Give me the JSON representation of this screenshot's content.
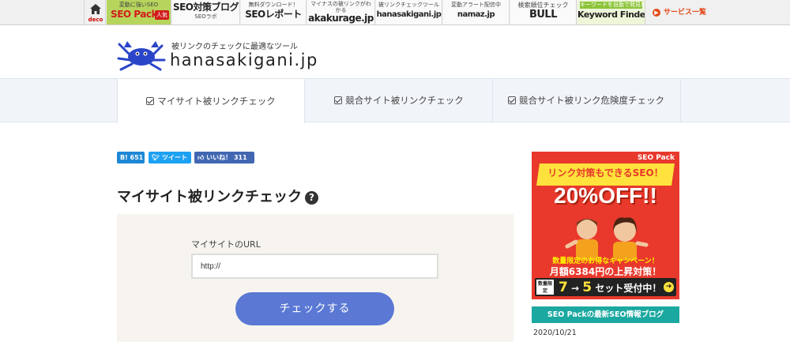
{
  "topbar": {
    "home": {
      "icon": "home-icon",
      "label": "deco"
    },
    "services": [
      {
        "sub": "変動に強いSEO",
        "name": "SEO Pack",
        "badge": "人気"
      },
      {
        "sub": "",
        "name": "SEO対策ブログ",
        "name2": "SEOラボ"
      },
      {
        "sub": "無料ダウンロード！",
        "name": "SEOレポート"
      },
      {
        "sub": "マイナスの被リンクがわかる",
        "name": "akakurage.jp"
      },
      {
        "sub": "被リンクチェックツール",
        "name": "hanasakigani.jp"
      },
      {
        "sub": "変動アラート配信中",
        "name": "namaz.jp"
      },
      {
        "sub": "検索順位チェック",
        "name": "BULL"
      },
      {
        "sub": "キーワードを自動で発見!",
        "name": "Keyword Finder"
      }
    ],
    "all_services": "サービス一覧"
  },
  "logo": {
    "tagline": "被リンクのチェックに最適なツール",
    "site": "hanasakigani.jp"
  },
  "tabs": [
    {
      "label": "マイサイト被リンクチェック",
      "active": true
    },
    {
      "label": "競合サイト被リンクチェック",
      "active": false
    },
    {
      "label": "競合サイト被リンク危険度チェック",
      "active": false
    }
  ],
  "share": {
    "hatena": "B! 651",
    "tweet": "ツイート",
    "like": "いいね！ 311"
  },
  "main": {
    "title": "マイサイト被リンクチェック",
    "help": "?",
    "url_label": "マイサイトのURL",
    "url_value": "http://",
    "submit": "チェックする"
  },
  "sidebar": {
    "ad": {
      "brand": "SEO Pack",
      "headline": "リンク対策もできるSEO！",
      "discount": "20%OFF!!",
      "promo": "数量限定のお得なキャンペーン！",
      "promo2": "月額6384円の上昇対策！",
      "limited": "数量限定",
      "offer_from": "7",
      "offer_arrow": "→",
      "offer_to": "5",
      "offer_text": "セット受付中！"
    },
    "blog_title": "SEO Packの最新SEO情報ブログ",
    "blog_date": "2020/10/21"
  },
  "colors": {
    "accent_button": "#5a78d4",
    "seopack_green": "#b7d45c",
    "ad_red": "#e8392c",
    "blog_teal": "#1ba8a0"
  }
}
